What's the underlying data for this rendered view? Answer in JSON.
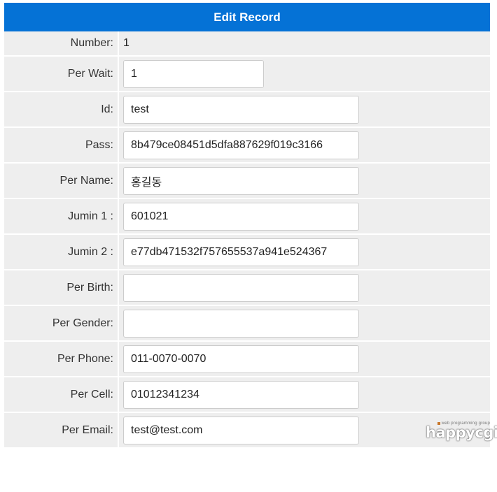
{
  "header": {
    "title": "Edit Record"
  },
  "form": {
    "number": {
      "label": "Number:",
      "value": "1"
    },
    "fields": [
      {
        "label": "Per Wait:",
        "value": "1"
      },
      {
        "label": "Id:",
        "value": "test"
      },
      {
        "label": "Pass:",
        "value": "8b479ce08451d5dfa887629f019c3166"
      },
      {
        "label": "Per Name:",
        "value": "홍길동"
      },
      {
        "label": "Jumin 1 :",
        "value": "601021"
      },
      {
        "label": "Jumin 2 :",
        "value": "e77db471532f757655537a941e524367"
      },
      {
        "label": "Per Birth:",
        "value": ""
      },
      {
        "label": "Per Gender:",
        "value": ""
      },
      {
        "label": "Per Phone:",
        "value": "011-0070-0070"
      },
      {
        "label": "Per Cell:",
        "value": "01012341234"
      },
      {
        "label": "Per Email:",
        "value": "test@test.com"
      }
    ]
  },
  "watermark": {
    "tagline": "web programming group",
    "logo": "happycgi"
  },
  "colors": {
    "header_bg": "#0572d6",
    "row_bg": "#eeeeee",
    "field_border": "#cccccc"
  }
}
